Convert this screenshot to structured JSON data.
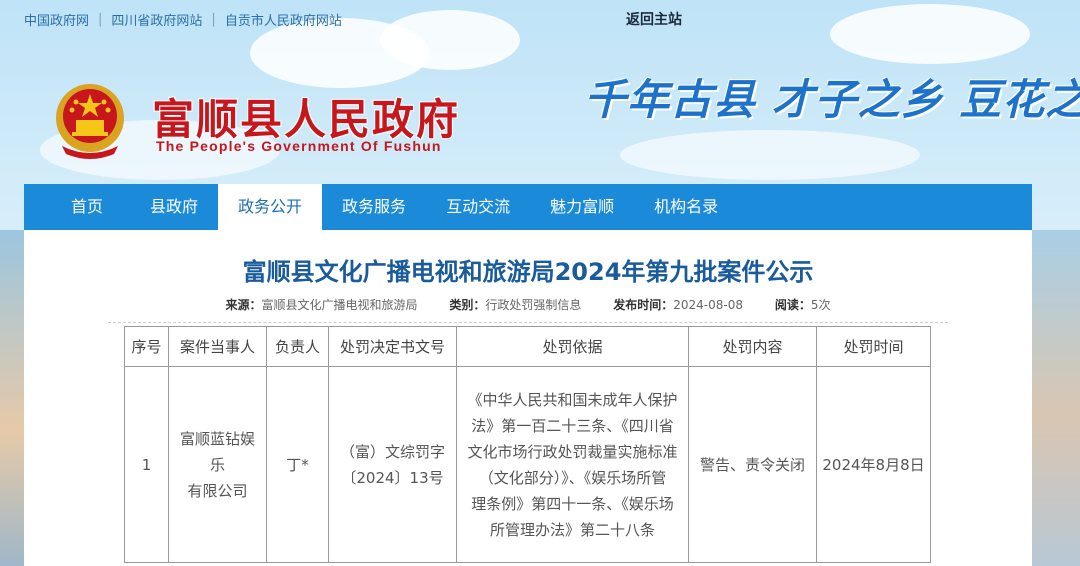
{
  "topbar": {
    "links": [
      "中国政府网",
      "四川省政府网站",
      "自贡市人民政府网站"
    ],
    "return_home": "返回主站"
  },
  "header": {
    "title": "富顺县人民政府",
    "subtitle": "The People's Government Of Fushun",
    "slogan": "千年古县  才子之乡  豆花之"
  },
  "nav": {
    "items": [
      "首页",
      "县政府",
      "政务公开",
      "政务服务",
      "互动交流",
      "魅力富顺",
      "机构名录"
    ],
    "active_index": 2
  },
  "article": {
    "title": "富顺县文化广播电视和旅游局2024年第九批案件公示",
    "meta": {
      "source_label": "来源：",
      "source": "富顺县文化广播电视和旅游局",
      "category_label": "类别：",
      "category": "行政处罚强制信息",
      "date_label": "发布时间：",
      "date": "2024-08-08",
      "reads_label": "阅读：",
      "reads": "5次"
    }
  },
  "table": {
    "headers": [
      "序号",
      "案件当事人",
      "负责人",
      "处罚决定书文号",
      "处罚依据",
      "处罚内容",
      "处罚时间"
    ],
    "row": {
      "index": "1",
      "party_line1": "富顺蓝钻娱乐",
      "party_line2": "有限公司",
      "owner": "丁*",
      "doc_line1": "（富）文综罚字",
      "doc_line2": "〔2024〕13号",
      "basis_lines": [
        "《中华人民共和国未成年人保护",
        "法》第一百二十三条、《四川省",
        "文化市场行政处罚裁量实施标准",
        "（文化部分）》、《娱乐场所管",
        "理条例》第四十一条、《娱乐场",
        "所管理办法》第二十八条"
      ],
      "content": "警告、责令关闭",
      "time": "2024年8月8日"
    }
  },
  "colors": {
    "nav_bg": "#1b8ad8",
    "title_red": "#c8161d",
    "article_title": "#1a5b9c",
    "slogan_blue": "#1d73c9"
  }
}
